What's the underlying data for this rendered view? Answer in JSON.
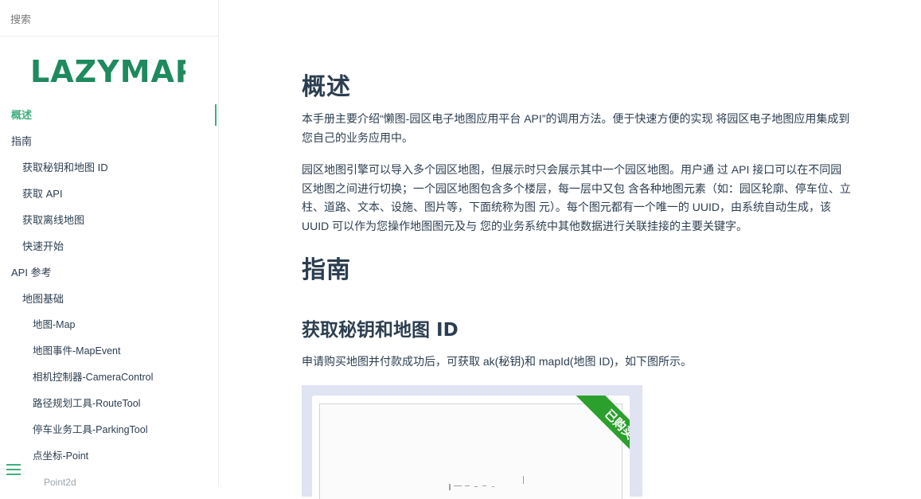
{
  "sidebar": {
    "search_placeholder": "搜索",
    "logo_text": "LAZYMAP",
    "items": [
      {
        "label": "概述",
        "level": 0,
        "active": true
      },
      {
        "label": "指南",
        "level": 0
      },
      {
        "label": "获取秘钥和地图 ID",
        "level": 1
      },
      {
        "label": "获取 API",
        "level": 1
      },
      {
        "label": "获取离线地图",
        "level": 1
      },
      {
        "label": "快速开始",
        "level": 1
      },
      {
        "label": "API 参考",
        "level": 0
      },
      {
        "label": "地图基础",
        "level": 1
      },
      {
        "label": "地图-Map",
        "level": 2
      },
      {
        "label": "地图事件-MapEvent",
        "level": 2
      },
      {
        "label": "相机控制器-CameraControl",
        "level": 2
      },
      {
        "label": "路径规划工具-RouteTool",
        "level": 2
      },
      {
        "label": "停车业务工具-ParkingTool",
        "level": 2
      },
      {
        "label": "点坐标-Point",
        "level": 2
      },
      {
        "label": "Point2d",
        "level": 3
      }
    ]
  },
  "main": {
    "overview_title": "概述",
    "overview_p1": "本手册主要介绍“懒图-园区电子地图应用平台 API”的调用方法。便于快速方便的实现 将园区电子地图应用集成到您自己的业务应用中。",
    "overview_p2": "园区地图引擎可以导入多个园区地图，但展示时只会展示其中一个园区地图。用户通 过 API 接口可以在不同园区地图之间进行切换；一个园区地图包含多个楼层，每一层中又包 含各种地图元素（如：园区轮廓、停车位、立柱、道路、文本、设施、图片等，下面统称为图 元）。每个图元都有一个唯一的 UUID，由系统自动生成，该 UUID 可以作为您操作地图图元及与 您的业务系统中其他数据进行关联挂接的主要关键字。",
    "guide_title": "指南",
    "key_title": "获取秘钥和地图 ID",
    "key_p": "申请购买地图并付款成功后，可获取 ak(秘钥)和 mapId(地图 ID)，如下图所示。",
    "ribbon_text": "已购买"
  },
  "colors": {
    "accent": "#3eaf7c",
    "text": "#2c3e50",
    "logo": "#1e8a5e",
    "ribbon": "#2ca02c"
  }
}
